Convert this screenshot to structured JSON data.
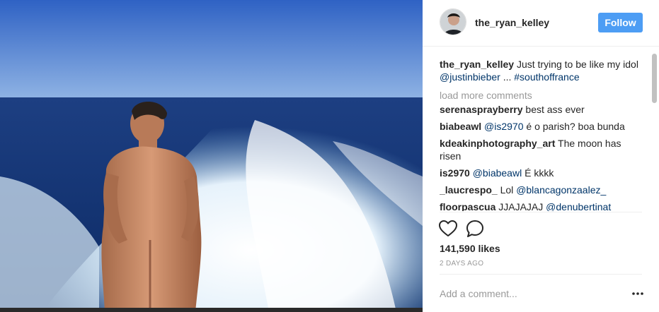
{
  "post": {
    "image_alt": "Man standing on the back of a boat with a white wake and blue sea",
    "header": {
      "username": "the_ryan_kelley",
      "follow_label": "Follow"
    },
    "caption": {
      "user": "the_ryan_kelley",
      "text_before": " Just trying to be like my idol ",
      "mention": "@justinbieber",
      "text_middle": " ... ",
      "hashtag": "#southoffrance"
    },
    "load_more_label": "load more comments",
    "comments": [
      {
        "user": "serenasprayberry",
        "mention": "",
        "text": " best ass ever"
      },
      {
        "user": "biabeawl",
        "mention": "@is2970",
        "text": " é o parish? boa bunda"
      },
      {
        "user": "kdeakinphotography_art",
        "mention": "",
        "text": " The moon has risen"
      },
      {
        "user": "is2970",
        "mention": "@biabeawl",
        "text": " É kkkk"
      },
      {
        "user": "_laucrespo_",
        "mention": "",
        "text": " Lol ",
        "mention_after": "@blancagonzaalez_"
      },
      {
        "user": "floorpascua",
        "mention": "",
        "text": " JJAJAJAJ ",
        "mention_after": "@denubertinat"
      }
    ],
    "actions": {
      "like_icon": "heart-icon",
      "comment_icon": "comment-bubble-icon"
    },
    "likes_label": "141,590 likes",
    "likes_count": 141590,
    "timestamp": "2 DAYS AGO",
    "add_comment_placeholder": "Add a comment...",
    "more_icon": "ellipsis-icon"
  },
  "colors": {
    "follow_button": "#4d9df4",
    "link": "#003569",
    "muted": "#999999",
    "text": "#262626"
  }
}
